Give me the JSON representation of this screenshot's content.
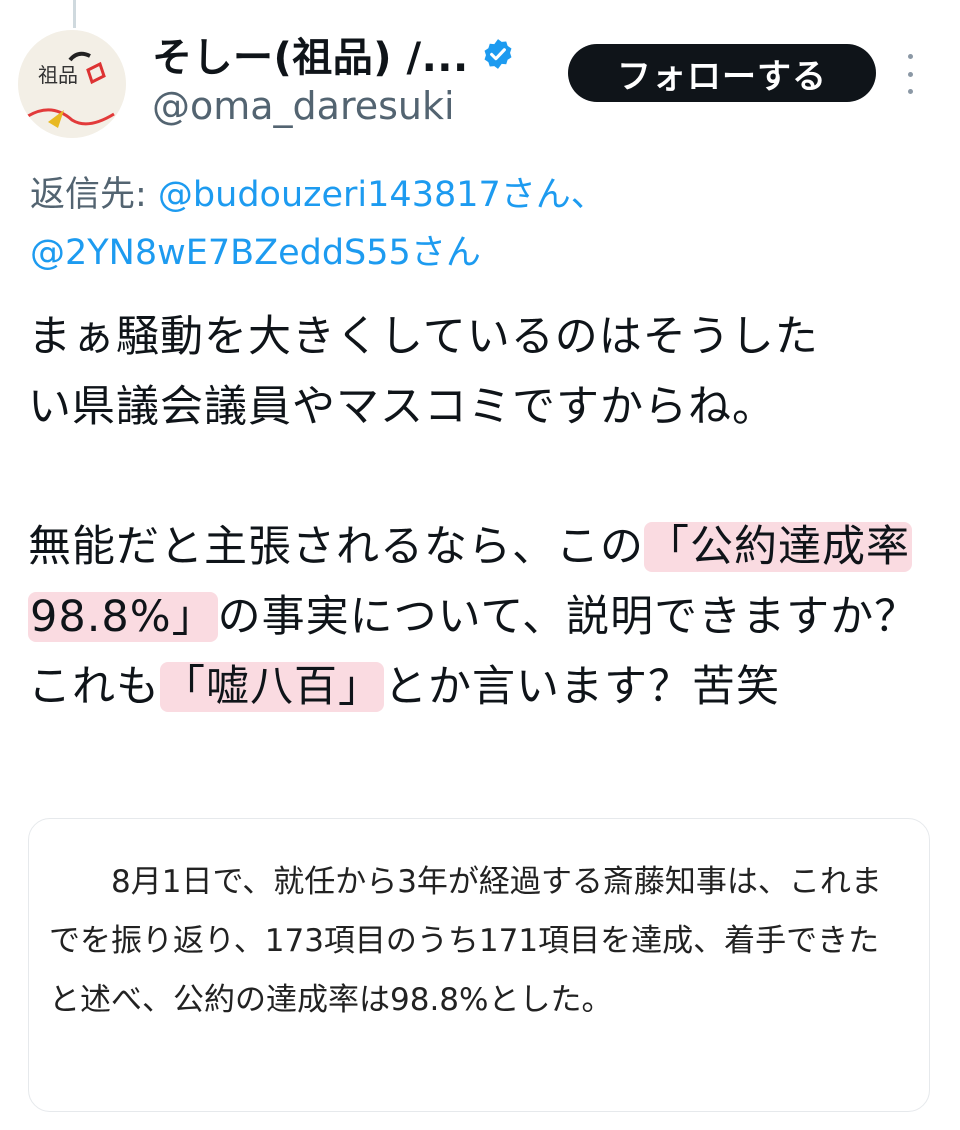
{
  "author": {
    "display_name": "そしー(祖品) /...",
    "handle": "@oma_daresuki",
    "avatar_text": "祖品",
    "verified": true
  },
  "header": {
    "follow_label": "フォローする",
    "more_icon": "more-vertical-icon"
  },
  "reply": {
    "prefix": "返信先: ",
    "mention_1": "@budouzeri143817さん、",
    "mention_2": "@2YN8wE7BZeddS55さん"
  },
  "tweet": {
    "p1_line1": "まぁ騒動を大きくしているのはそうした",
    "p1_line2": "い県議会議員やマスコミですからね。",
    "p2_seg1": "無能だと主張されるなら、この",
    "p2_hl1": "「公約達成率98.8%」",
    "p2_seg2": "の事実について、説明できますか？これも",
    "p2_hl2": "「嘘八百」",
    "p2_seg3": "とか言います？苦笑"
  },
  "quote": {
    "text": "8月1日で、就任から3年が経過する斎藤知事は、これまでを振り返り、173項目のうち171項目を達成、着手できたと述べ、公約の達成率は98.8%とした。"
  },
  "colors": {
    "link": "#1d9bf0",
    "highlight": "#fadbe1",
    "follow_bg": "#0f1419",
    "verified": "#1d9bf0",
    "secondary_text": "#536471"
  }
}
